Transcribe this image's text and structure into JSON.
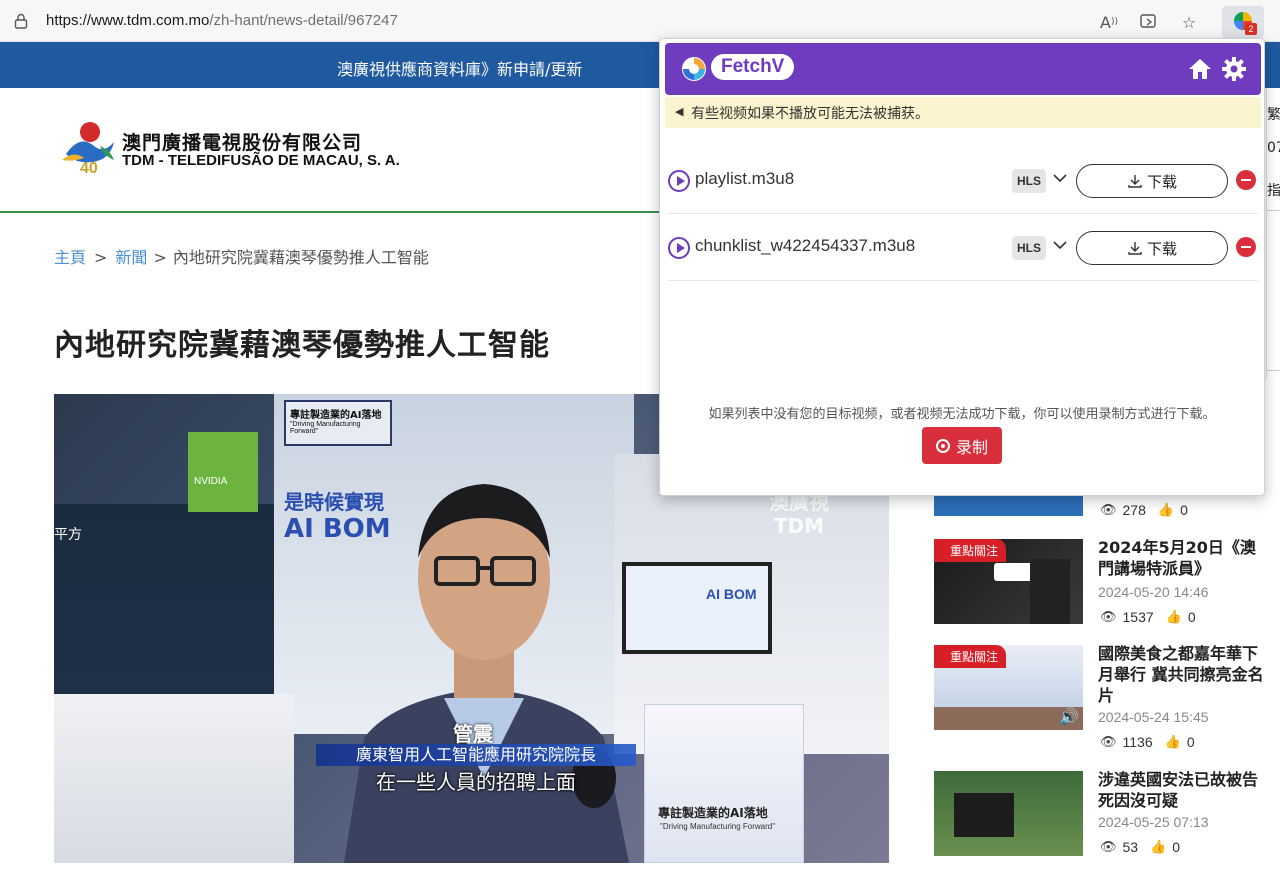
{
  "browser": {
    "url_host": "https://www.tdm.com.mo",
    "url_path": "/zh-hant/news-detail/967247",
    "extension_badge": "2"
  },
  "page": {
    "top_banner": "澳廣視供應商資料庫》新申請/更新",
    "logo_cn": "澳門廣播電視股份有限公司",
    "logo_en": "TDM - TELEDIFUSÃO DE MACAU, S. A.",
    "logo_year": "40",
    "breadcrumb": {
      "home": "主頁",
      "news": "新聞",
      "current": "內地研究院冀藉澳琴優勢推人工智能"
    },
    "headline": "內地研究院冀藉澳琴優勢推人工智能",
    "video": {
      "name_caption": "管震",
      "title_caption": "廣東智用人工智能應用研究院院長",
      "subtitle": "在一些人員的招聘上面",
      "sign_cn": "專註製造業的AI落地",
      "sign_en": "\"Driving Manufacturing Forward\"",
      "wall_text": "是時候實現",
      "aibom": "AI BOM",
      "screen_text": "AI BOM",
      "podium_cn": "專註製造業的AI落地",
      "podium_en": "\"Driving Manufacturing Forward\"",
      "watermark_line1": "澳廣視",
      "watermark_line2": "TDM",
      "nvidia": "NVIDIA",
      "left_booth": "平方"
    },
    "sidebar": [
      {
        "tag": "",
        "title": "",
        "date": "",
        "views": "278",
        "likes": "0"
      },
      {
        "tag": "重點關注",
        "title": "2024年5月20日《澳門講場特派員》",
        "date": "2024-05-20 14:46",
        "views": "1537",
        "likes": "0"
      },
      {
        "tag": "重點關注",
        "title": "國際美食之都嘉年華下月舉行 冀共同擦亮金名片",
        "date": "2024-05-24 15:45",
        "views": "1136",
        "likes": "0"
      },
      {
        "tag": "",
        "title": "涉違英國安法已故被告死因沒可疑",
        "date": "2024-05-25 07:13",
        "views": "53",
        "likes": "0"
      }
    ],
    "right_clip": [
      "繁",
      "07",
      "指"
    ]
  },
  "fetchv": {
    "brand": "FetchV",
    "notice": "有些视频如果不播放可能无法被捕获。",
    "items": [
      {
        "filename": "playlist.m3u8",
        "format": "HLS",
        "download_label": "下载"
      },
      {
        "filename": "chunklist_w422454337.m3u8",
        "format": "HLS",
        "download_label": "下载"
      }
    ],
    "hint": "如果列表中没有您的目标视频，或者视频无法成功下载，你可以使用录制方式进行下载。",
    "record_label": "录制"
  },
  "colors": {
    "fetchv_purple": "#6f3bbf",
    "tdm_blue": "#1f5aa0",
    "danger_red": "#d92e3b",
    "tag_red": "#d61f26",
    "notice_yellow": "#fcf3cf"
  }
}
